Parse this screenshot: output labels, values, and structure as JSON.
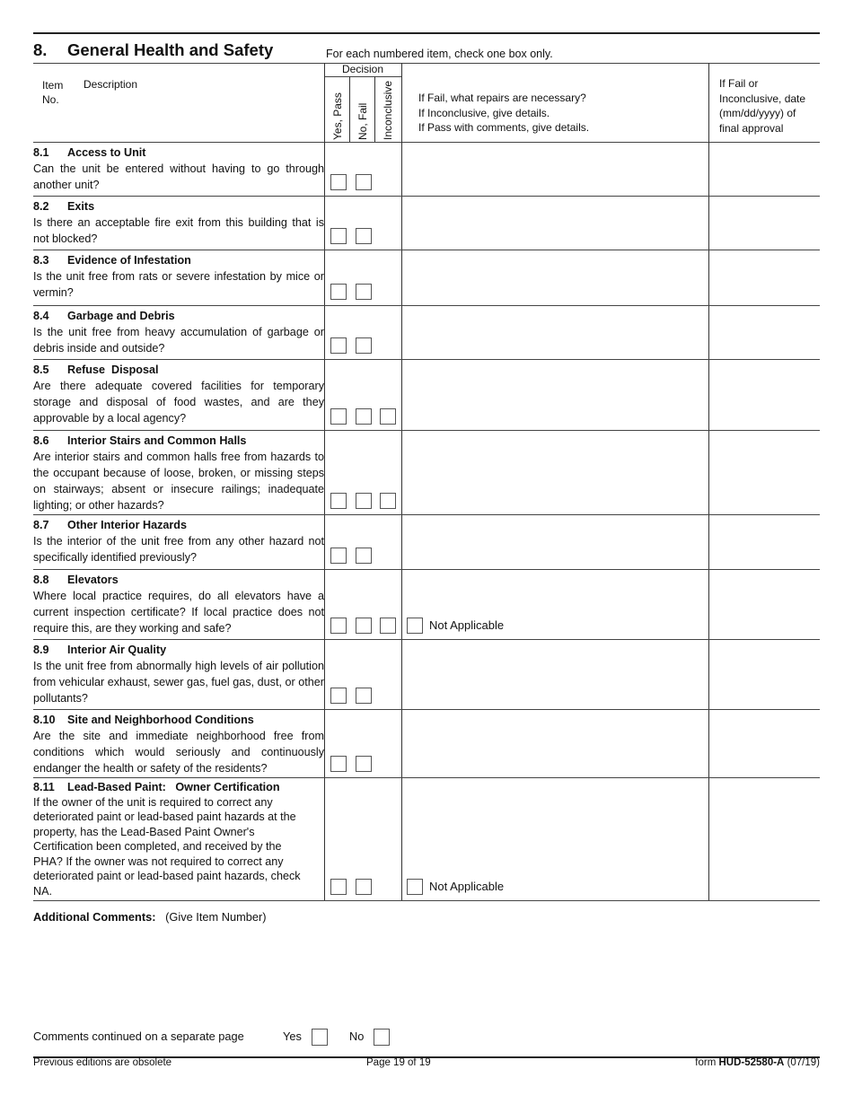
{
  "section": {
    "number": "8.",
    "title": "General Health and Safety",
    "instruction": "For each numbered item, check one box only."
  },
  "header": {
    "item": "Item",
    "no": "No.",
    "description": "Description",
    "decision": "Decision",
    "decision_columns": [
      "Yes, Pass",
      "No, Fail",
      "Inconclusive"
    ],
    "repairs_lines": [
      "If Fail, what repairs are necessary?",
      "If Inconclusive, give details.",
      "If Pass with comments, give details."
    ],
    "date_lines": [
      "If Fail or",
      "Inconclusive, date",
      "(mm/dd/yyyy) of",
      "final approval"
    ]
  },
  "items": [
    {
      "number": "8.1",
      "title": "Access to Unit",
      "description": "Can the unit be entered without having to go through another unit?",
      "boxes": 2,
      "not_applicable": false
    },
    {
      "number": "8.2",
      "title": "Exits",
      "description": "Is there an acceptable fire exit from this building that is not blocked?",
      "boxes": 2,
      "not_applicable": false
    },
    {
      "number": "8.3",
      "title": "Evidence of Infestation",
      "description": "Is the unit free from rats or severe infestation by mice or vermin?",
      "boxes": 2,
      "not_applicable": false
    },
    {
      "number": "8.4",
      "title": "Garbage and Debris",
      "description": "Is the unit free from heavy accumulation of garbage or debris inside and outside?",
      "boxes": 2,
      "not_applicable": false
    },
    {
      "number": "8.5",
      "title": "Refuse  Disposal",
      "description": "Are there adequate covered facilities for temporary storage and disposal of food wastes, and are they approvable by a local agency?",
      "boxes": 3,
      "not_applicable": false
    },
    {
      "number": "8.6",
      "title": "Interior Stairs and Common Halls",
      "description": "Are interior stairs and common halls free from hazards to the occupant because of loose, broken, or missing steps on stairways; absent or insecure railings; inadequate lighting; or other hazards?",
      "boxes": 3,
      "not_applicable": false
    },
    {
      "number": "8.7",
      "title": "Other Interior Hazards",
      "description": "Is the interior of the unit free from any other hazard not specifically identified previously?",
      "boxes": 2,
      "not_applicable": false
    },
    {
      "number": "8.8",
      "title": "Elevators",
      "description": "Where local practice requires, do all elevators have a current inspection certificate?  If local practice does not require this, are they working and safe?",
      "boxes": 3,
      "not_applicable": true
    },
    {
      "number": "8.9",
      "title": "Interior Air Quality",
      "description": "Is the unit free from abnormally high levels of air pollution from vehicular exhaust, sewer gas, fuel gas, dust, or other pollutants?",
      "boxes": 2,
      "not_applicable": false
    },
    {
      "number": "8.10",
      "title": "Site and Neighborhood Conditions",
      "description": "Are the site and immediate neighborhood free from conditions which would seriously and continuously endanger the health or safety of the residents?",
      "boxes": 2,
      "not_applicable": false
    },
    {
      "number": "8.11",
      "title": "Lead-Based Paint:   Owner Certification",
      "description": "If the owner of the unit is required to correct any deteriorated paint or lead-based paint hazards at the property, has the Lead-Based Paint Owner's Certification been completed, and received by the PHA?   If the owner was not required to correct any deteriorated paint or lead-based paint hazards, check NA.",
      "boxes": 2,
      "not_applicable": true
    }
  ],
  "not_applicable_label": "Not Applicable",
  "comments": {
    "label": "Additional Comments:",
    "hint": "(Give Item Number)",
    "continued_label": "Comments continued on a separate page",
    "yes_label": "Yes",
    "no_label": "No"
  },
  "footer": {
    "left": "Previous editions are obsolete",
    "center": "Page 19 of 19",
    "form_prefix": "form",
    "form_id": "HUD-52580-A",
    "form_date": "(07/19)"
  }
}
